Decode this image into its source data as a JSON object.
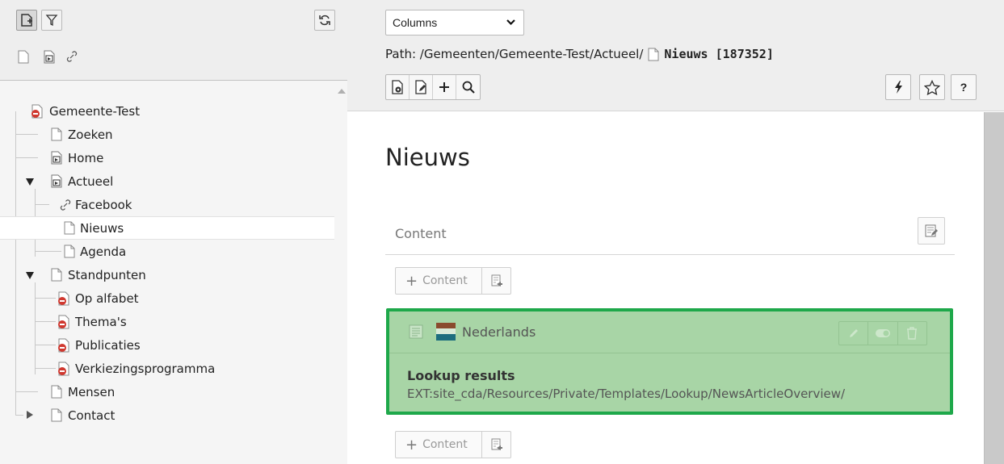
{
  "colors": {
    "panel_bg": "#eeeeee",
    "tree_bg": "#f5f5f5",
    "highlight_green": "#1ea84a",
    "content_green_bg": "#a8d5a6",
    "blocked_red": "#d0382f"
  },
  "left_toolbar": {
    "buttons": [
      {
        "icon": "new-page-icon"
      },
      {
        "icon": "filter-icon"
      },
      {
        "icon": "refresh-icon"
      }
    ],
    "doktypes": [
      {
        "icon": "page-icon"
      },
      {
        "icon": "shortcut-page-icon"
      },
      {
        "icon": "link-icon"
      }
    ]
  },
  "tree": {
    "items": [
      {
        "label": "Gemeente-Test",
        "icon": "page-blocked-icon"
      },
      {
        "label": "Zoeken",
        "icon": "page-icon"
      },
      {
        "label": "Home",
        "icon": "shortcut-page-icon"
      },
      {
        "label": "Actueel",
        "icon": "shortcut-page-icon",
        "expanded": true
      },
      {
        "label": "Facebook",
        "icon": "link-icon"
      },
      {
        "label": "Nieuws",
        "icon": "page-icon",
        "selected": true
      },
      {
        "label": "Agenda",
        "icon": "page-icon"
      },
      {
        "label": "Standpunten",
        "icon": "page-icon",
        "expanded": true
      },
      {
        "label": "Op alfabet",
        "icon": "page-blocked-icon"
      },
      {
        "label": "Thema's",
        "icon": "page-blocked-icon"
      },
      {
        "label": "Publicaties",
        "icon": "page-blocked-icon"
      },
      {
        "label": "Verkiezingsprogramma",
        "icon": "page-blocked-icon"
      },
      {
        "label": "Mensen",
        "icon": "page-icon"
      },
      {
        "label": "Contact",
        "icon": "page-icon",
        "collapsed": true
      }
    ]
  },
  "header": {
    "view_select": "Columns",
    "path_label": "Path: /Gemeenten/Gemeente-Test/Actueel/",
    "path_current": "Nieuws [187352]",
    "toolbar_left": [
      {
        "icon": "view-page-icon"
      },
      {
        "icon": "edit-page-icon"
      },
      {
        "icon": "plus-icon"
      },
      {
        "icon": "search-icon"
      }
    ],
    "toolbar_right": [
      {
        "icon": "lightning-icon"
      },
      {
        "icon": "star-icon"
      },
      {
        "icon": "help-icon",
        "label": "?"
      }
    ]
  },
  "main": {
    "page_title": "Nieuws",
    "column_title": "Content",
    "add_content_label": "Content",
    "content_element": {
      "language": "Nederlands",
      "title": "Lookup results",
      "path": "EXT:site_cda/Resources/Private/Templates/Lookup/NewsArticleOverview/"
    }
  }
}
